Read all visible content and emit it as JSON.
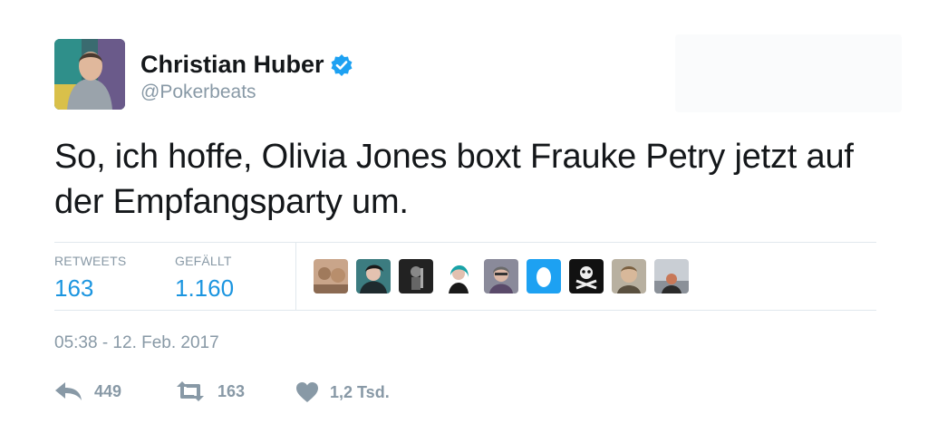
{
  "user": {
    "display_name": "Christian Huber",
    "handle": "@Pokerbeats",
    "verified": true
  },
  "tweet": {
    "text": "So, ich hoffe, Olivia Jones boxt Frauke Petry jetzt auf der Empfangsparty um."
  },
  "stats": {
    "retweets_label": "RETWEETS",
    "retweets_value": "163",
    "likes_label": "GEFÄLLT",
    "likes_value": "1.160"
  },
  "timestamp": "05:38 - 12. Feb. 2017",
  "actions": {
    "reply_count": "449",
    "retweet_count": "163",
    "like_count": "1,2 Tsd."
  },
  "colors": {
    "accent": "#1b95e0",
    "muted": "#8899a6",
    "verified": "#1da1f2"
  }
}
